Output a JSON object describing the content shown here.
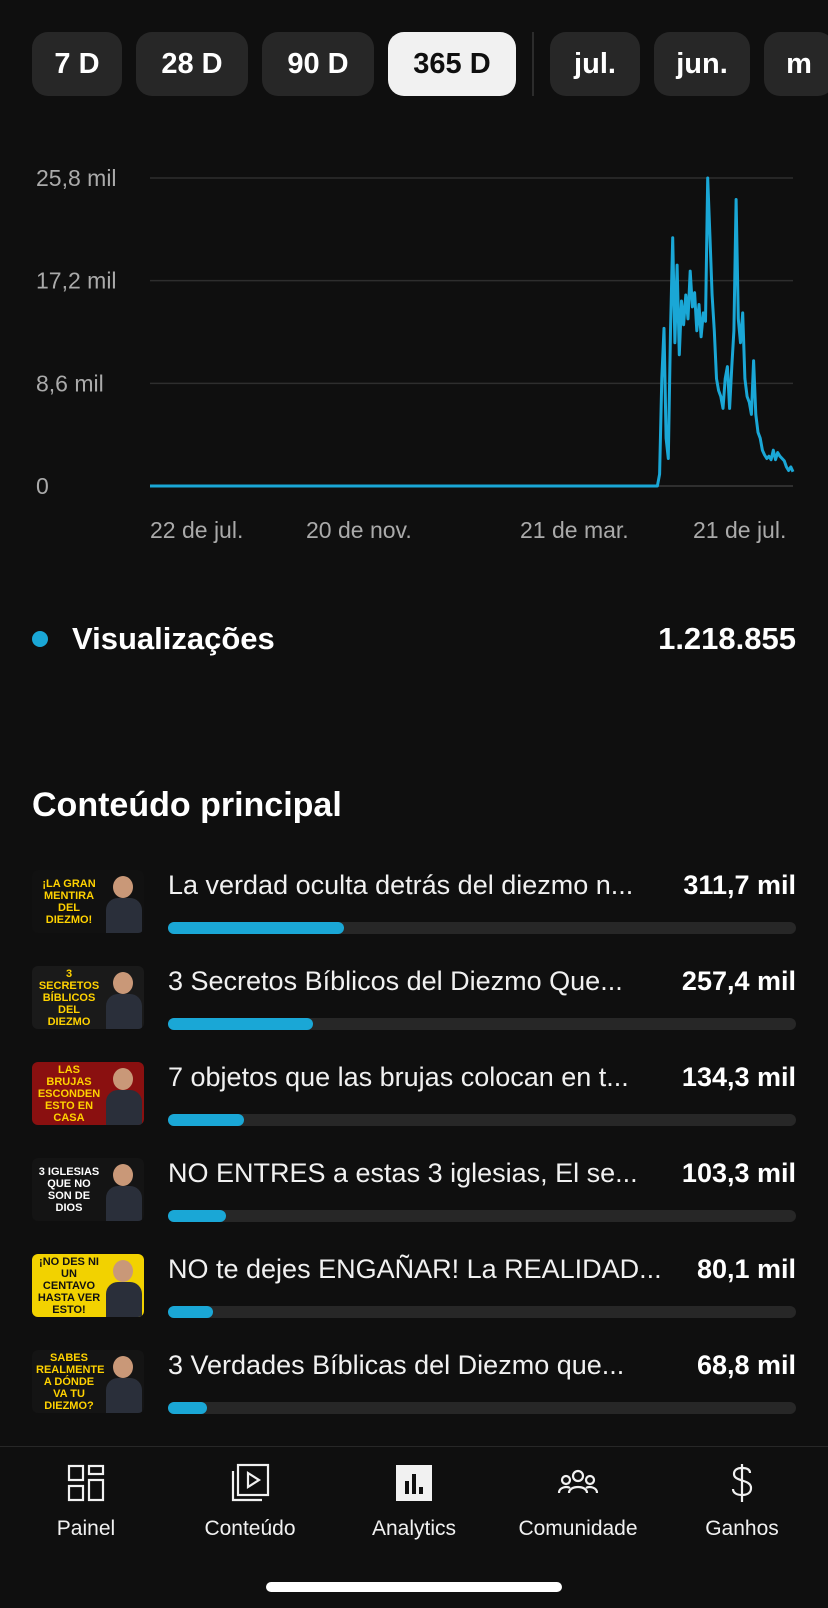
{
  "periods": {
    "items": [
      "7 D",
      "28 D",
      "90 D",
      "365 D"
    ],
    "active": "365 D",
    "months": [
      "jul.",
      "jun.",
      "m"
    ]
  },
  "chart_data": {
    "type": "line",
    "y_ticks": [
      "25,8 mil",
      "17,2 mil",
      "8,6 mil",
      "0"
    ],
    "y_tick_values": [
      25800,
      17200,
      8600,
      0
    ],
    "x_ticks": [
      "22 de jul.",
      "20 de nov.",
      "21 de mar.",
      "21 de jul."
    ],
    "ylim": [
      0,
      25800
    ],
    "grid": true,
    "color": "#1aa7d6",
    "series": [
      {
        "name": "Visualizações",
        "points": [
          [
            0,
            0
          ],
          [
            200,
            0
          ],
          [
            232,
            0
          ],
          [
            233,
            1000
          ],
          [
            234,
            9000
          ],
          [
            235,
            13200
          ],
          [
            236,
            4000
          ],
          [
            237,
            2300
          ],
          [
            238,
            13000
          ],
          [
            239,
            20800
          ],
          [
            240,
            12000
          ],
          [
            241,
            18500
          ],
          [
            242,
            11000
          ],
          [
            243,
            15500
          ],
          [
            244,
            13500
          ],
          [
            245,
            16000
          ],
          [
            246,
            14000
          ],
          [
            247,
            18000
          ],
          [
            248,
            15000
          ],
          [
            249,
            16200
          ],
          [
            250,
            13000
          ],
          [
            251,
            15200
          ],
          [
            252,
            12500
          ],
          [
            253,
            14500
          ],
          [
            254,
            13800
          ],
          [
            255,
            25800
          ],
          [
            256,
            21000
          ],
          [
            257,
            16000
          ],
          [
            258,
            13000
          ],
          [
            259,
            9000
          ],
          [
            260,
            8000
          ],
          [
            261,
            7500
          ],
          [
            262,
            6500
          ],
          [
            263,
            9000
          ],
          [
            264,
            10000
          ],
          [
            265,
            6500
          ],
          [
            266,
            10000
          ],
          [
            267,
            13000
          ],
          [
            268,
            24000
          ],
          [
            269,
            14000
          ],
          [
            270,
            12000
          ],
          [
            271,
            14500
          ],
          [
            272,
            9000
          ],
          [
            273,
            7500
          ],
          [
            274,
            7000
          ],
          [
            275,
            6000
          ],
          [
            276,
            10500
          ],
          [
            277,
            6000
          ],
          [
            278,
            4500
          ],
          [
            279,
            4000
          ],
          [
            280,
            3000
          ],
          [
            281,
            2600
          ],
          [
            282,
            2300
          ],
          [
            283,
            2500
          ],
          [
            284,
            2200
          ],
          [
            285,
            3000
          ],
          [
            286,
            2200
          ],
          [
            287,
            2800
          ],
          [
            288,
            2500
          ],
          [
            289,
            2300
          ],
          [
            290,
            2100
          ],
          [
            291,
            1600
          ],
          [
            292,
            1300
          ],
          [
            293,
            1600
          ],
          [
            294,
            1200
          ]
        ]
      }
    ]
  },
  "legend": {
    "label": "Visualizações",
    "total": "1.218.855",
    "color": "#1aa7d6"
  },
  "top_content": {
    "title": "Conteúdo principal",
    "items": [
      {
        "title": "La verdad oculta detrás del diezmo n...",
        "value": "311,7 mil",
        "share": 1.0,
        "thumb_text": "¡La gran mentira del diezmo!",
        "thumb_bg": "#111111",
        "thumb_fg": "#ffd200"
      },
      {
        "title": "3 Secretos Bíblicos del Diezmo Que...",
        "value": "257,4 mil",
        "share": 0.826,
        "thumb_text": "3 secretos bíblicos del diezmo",
        "thumb_bg": "#1a1a1a",
        "thumb_fg": "#ffd200"
      },
      {
        "title": "7 objetos que las brujas colocan en t...",
        "value": "134,3 mil",
        "share": 0.431,
        "thumb_text": "Las brujas esconden esto en casa",
        "thumb_bg": "#8a1010",
        "thumb_fg": "#ffd200"
      },
      {
        "title": "NO ENTRES a estas 3 iglesias,  El se...",
        "value": "103,3 mil",
        "share": 0.331,
        "thumb_text": "3 iglesias que no son de Dios",
        "thumb_bg": "#141414",
        "thumb_fg": "#ffffff"
      },
      {
        "title": "NO te dejes ENGAÑAR! La REALIDAD...",
        "value": "80,1 mil",
        "share": 0.257,
        "thumb_text": "¡No des ni un centavo hasta ver esto!",
        "thumb_bg": "#f2d200",
        "thumb_fg": "#111111"
      },
      {
        "title": "3 Verdades Bíblicas del Diezmo que...",
        "value": "68,8 mil",
        "share": 0.221,
        "thumb_text": "Sabes realmente a dónde va tu diezmo?",
        "thumb_bg": "#141414",
        "thumb_fg": "#ffd200"
      }
    ]
  },
  "nav": {
    "items": [
      {
        "label": "Painel",
        "icon": "dashboard-icon"
      },
      {
        "label": "Conteúdo",
        "icon": "content-play-icon"
      },
      {
        "label": "Analytics",
        "icon": "analytics-icon",
        "active": true
      },
      {
        "label": "Comunidade",
        "icon": "community-icon"
      },
      {
        "label": "Ganhos",
        "icon": "dollar-icon"
      }
    ]
  }
}
